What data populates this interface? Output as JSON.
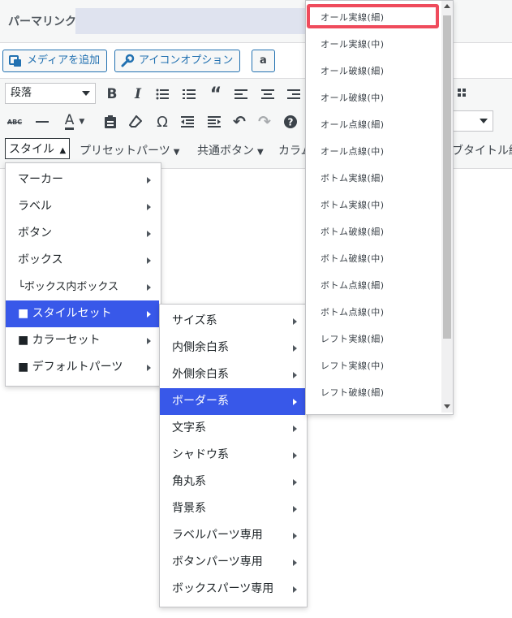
{
  "permalink": {
    "label": "パーマリンク:"
  },
  "media_buttons": {
    "add_media": "メディアを追加",
    "icon_options": "アイコンオプション",
    "amazon": "a"
  },
  "toolbar": {
    "format_select": "段落",
    "row3": {
      "style": "スタイル",
      "preset_parts": "プリセットパーツ",
      "common_buttons": "共通ボタン",
      "columns": "カラム",
      "subtitle": "ブタイトル編"
    }
  },
  "style_menu": [
    {
      "label": "マーカー",
      "active": false
    },
    {
      "label": "ラベル",
      "active": false
    },
    {
      "label": "ボタン",
      "active": false
    },
    {
      "label": "ボックス",
      "active": false
    },
    {
      "label": "└ボックス内ボックス",
      "active": false
    },
    {
      "label": "■ スタイルセット",
      "active": true
    },
    {
      "label": "■ カラーセット",
      "active": false
    },
    {
      "label": "■ デフォルトパーツ",
      "active": false
    }
  ],
  "styleset_menu": [
    {
      "label": "サイズ系",
      "active": false
    },
    {
      "label": "内側余白系",
      "active": false
    },
    {
      "label": "外側余白系",
      "active": false
    },
    {
      "label": "ボーダー系",
      "active": true
    },
    {
      "label": "文字系",
      "active": false
    },
    {
      "label": "シャドウ系",
      "active": false
    },
    {
      "label": "角丸系",
      "active": false
    },
    {
      "label": "背景系",
      "active": false
    },
    {
      "label": "ラベルパーツ専用",
      "active": false
    },
    {
      "label": "ボタンパーツ専用",
      "active": false
    },
    {
      "label": "ボックスパーツ専用",
      "active": false
    }
  ],
  "border_menu": [
    "オール実線(細)",
    "オール実線(中)",
    "オール破線(細)",
    "オール破線(中)",
    "オール点線(細)",
    "オール点線(中)",
    "ボトム実線(細)",
    "ボトム実線(中)",
    "ボトム破線(細)",
    "ボトム破線(中)",
    "ボトム点線(細)",
    "ボトム点線(中)",
    "レフト実線(細)",
    "レフト実線(中)",
    "レフト破線(細)"
  ],
  "colors": {
    "active_bg": "#3858e9",
    "highlight": "#ef4b5c",
    "link": "#2271b1"
  }
}
